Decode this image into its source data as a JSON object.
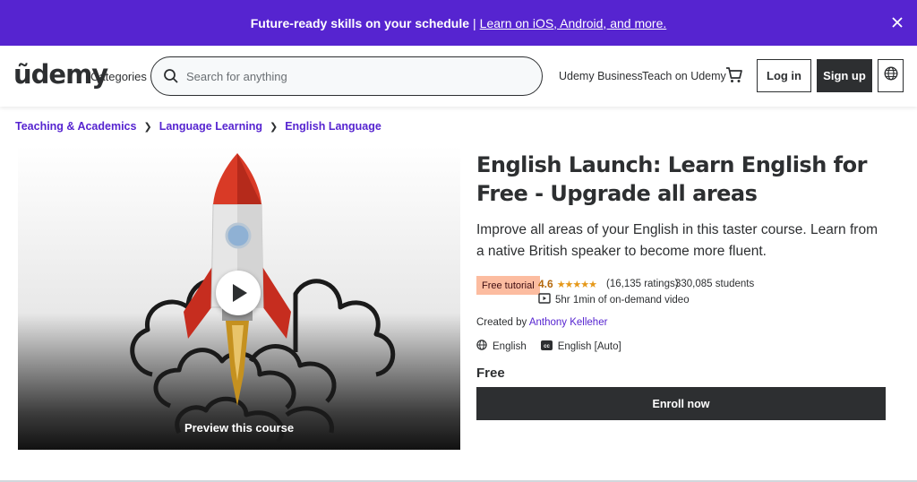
{
  "promo": {
    "headline": "Future-ready skills on your schedule",
    "separator": "|",
    "link": "Learn on iOS, Android, and more.",
    "close_icon": "close-icon",
    "bg_color": "#5624d0"
  },
  "header": {
    "logo": "ũdemy",
    "categories": "Categories",
    "search_placeholder": "Search for anything",
    "udemy_business": "Udemy Business",
    "teach": "Teach on Udemy",
    "cart_icon": "cart-icon",
    "login": "Log in",
    "signup": "Sign up",
    "globe_icon": "globe-icon"
  },
  "breadcrumb": [
    "Teaching & Academics",
    "Language Learning",
    "English Language"
  ],
  "preview": {
    "label": "Preview this course",
    "play_icon": "play-icon"
  },
  "course": {
    "title": "English Launch: Learn English for Free - Upgrade all areas",
    "subtitle": "Improve all areas of your English in this taster course. Learn from a native British speaker to become more fluent.",
    "badge": "Free tutorial",
    "rating": "4.6",
    "stars": "★★★★★",
    "rating_count": "(16,135 ratings)",
    "students": "330,085 students",
    "video_length": "5hr 1min of on-demand video",
    "created_by_label": "Created by",
    "instructor": "Anthony Kelleher",
    "language": "English",
    "captions": "English [Auto]",
    "price": "Free",
    "enroll": "Enroll now"
  },
  "colors": {
    "accent": "#5624d0",
    "dark": "#2d2f31",
    "badge_bg": "#fcbca0",
    "rating": "#b4690e"
  }
}
